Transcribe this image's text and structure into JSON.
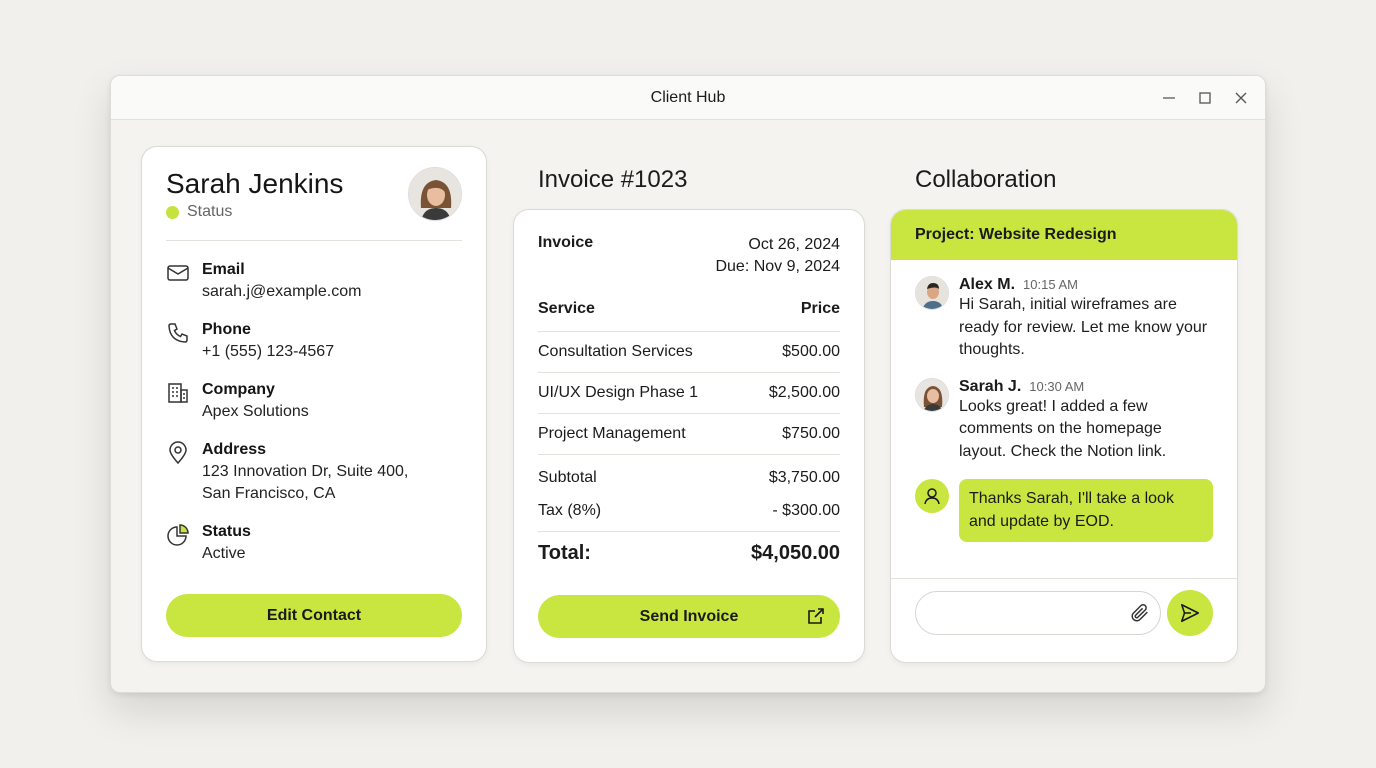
{
  "window": {
    "title": "Client Hub"
  },
  "contact": {
    "name": "Sarah Jenkins",
    "status_label": "Status",
    "fields": [
      {
        "icon": "mail-icon",
        "label": "Email",
        "value": "sarah.j@example.com"
      },
      {
        "icon": "phone-icon",
        "label": "Phone",
        "value": "+1 (555) 123-4567"
      },
      {
        "icon": "building-icon",
        "label": "Company",
        "value": "Apex Solutions"
      },
      {
        "icon": "map-pin-icon",
        "label": "Address",
        "value": "123 Innovation Dr, Suite 400,",
        "value2": "San Francisco, CA"
      },
      {
        "icon": "pie-chart-icon",
        "label": "Status",
        "value": "Active"
      }
    ],
    "edit_button": "Edit Contact"
  },
  "invoice": {
    "section_title": "Invoice #1023",
    "label": "Invoice",
    "date": "Oct 26, 2024",
    "due": "Due: Nov 9, 2024",
    "columns": [
      "Service",
      "Price"
    ],
    "items": [
      {
        "service": "Consultation Services",
        "price": "$500.00"
      },
      {
        "service": "UI/UX Design Phase 1",
        "price": "$2,500.00"
      },
      {
        "service": "Project Management",
        "price": "$750.00"
      }
    ],
    "subtotal_label": "Subtotal",
    "subtotal": "$3,750.00",
    "tax_label": "Tax (8%)",
    "tax": "- $300.00",
    "total_label": "Total:",
    "total": "$4,050.00",
    "send_button": "Send Invoice"
  },
  "collab": {
    "section_title": "Collaboration",
    "project": "Project: Website Redesign",
    "messages": [
      {
        "author": "Alex M.",
        "time": "10:15 AM",
        "text": "Hi Sarah, initial wireframes are ready for review. Let me know your thoughts."
      },
      {
        "author": "Sarah J.",
        "time": "10:30 AM",
        "text": "Looks great! I added a few comments on the homepage layout. Check the Notion link."
      }
    ],
    "my_message": "Thanks Sarah, I'll take a look and update by EOD.",
    "compose_placeholder": ""
  },
  "colors": {
    "accent": "#c8e63f",
    "status_dot": "#c5e23e",
    "background": "#f1f0ec"
  }
}
